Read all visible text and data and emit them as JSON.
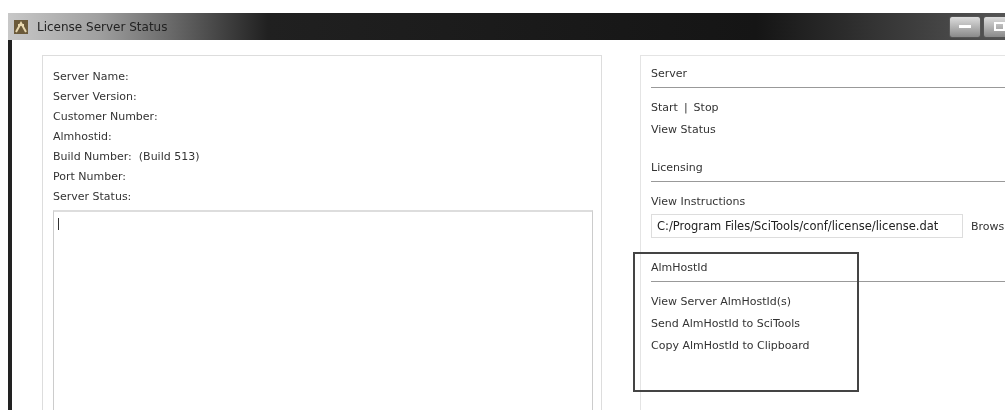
{
  "window": {
    "title": "License Server Status"
  },
  "info": {
    "labels": [
      {
        "label": "Server Name:"
      },
      {
        "label": "Server Version:"
      },
      {
        "label": "Customer Number:"
      },
      {
        "label": "Almhostid:"
      },
      {
        "label": "Build Number:",
        "value": "(Build 513)"
      },
      {
        "label": "Port Number:"
      },
      {
        "label": "Server Status:"
      }
    ]
  },
  "server": {
    "heading": "Server",
    "start": "Start",
    "separator": "|",
    "stop": "Stop",
    "view_status": "View Status"
  },
  "licensing": {
    "heading": "Licensing",
    "view_instructions": "View Instructions",
    "license_path": "C:/Program Files/SciTools/conf/license/license.dat",
    "browse": "Brows"
  },
  "almhostid": {
    "heading": "AlmHostId",
    "highlighted": true,
    "links": [
      "View Server AlmHostId(s)",
      "Send AlmHostId to SciTools",
      "Copy AlmHostId to Clipboard"
    ]
  }
}
